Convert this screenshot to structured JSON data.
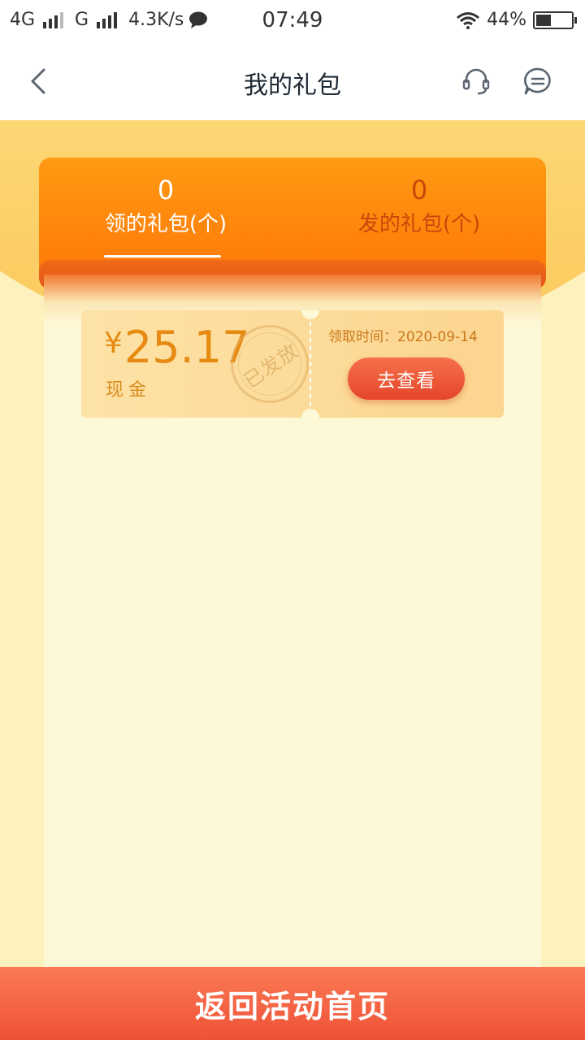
{
  "status_bar": {
    "network1": "4G",
    "network2": "G",
    "speed": "4.3K/s",
    "time": "07:49",
    "battery": "44%",
    "battery_level": 0.44
  },
  "nav": {
    "title": "我的礼包"
  },
  "tabs": [
    {
      "count": "0",
      "label": "领的礼包(个)",
      "active": true
    },
    {
      "count": "0",
      "label": "发的礼包(个)",
      "active": false
    }
  ],
  "coupon": {
    "currency": "¥",
    "amount": "25.17",
    "type": "现金",
    "stamp": "已发放",
    "claim_time": "领取时间：2020-09-14",
    "button": "去查看"
  },
  "bottom_button": "返回活动首页",
  "colors": {
    "accent_orange": "#ff7f0a",
    "button_red": "#ee5236",
    "coupon_text": "#e68a12"
  },
  "icons": [
    "back-arrow-icon",
    "customer-service-icon",
    "message-icon",
    "chat-bubble-icon",
    "wifi-icon",
    "battery-icon"
  ]
}
